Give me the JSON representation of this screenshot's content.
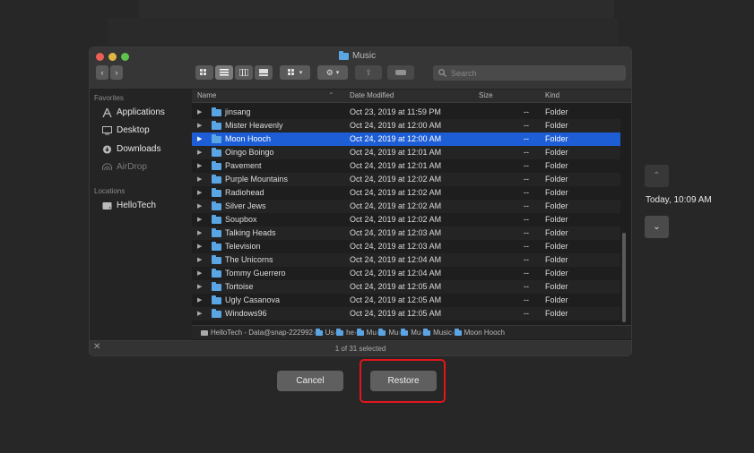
{
  "window": {
    "title": "Music",
    "search_placeholder": "Search"
  },
  "sidebar": {
    "favorites_label": "Favorites",
    "favorites": [
      {
        "label": "Applications",
        "icon": "applications-icon"
      },
      {
        "label": "Desktop",
        "icon": "desktop-icon"
      },
      {
        "label": "Downloads",
        "icon": "downloads-icon"
      },
      {
        "label": "AirDrop",
        "icon": "airdrop-icon"
      }
    ],
    "locations_label": "Locations",
    "locations": [
      {
        "label": "HelloTech",
        "icon": "disk-icon"
      }
    ]
  },
  "columns": {
    "name": "Name",
    "date": "Date Modified",
    "size": "Size",
    "kind": "Kind"
  },
  "rows": [
    {
      "name": "jinsang",
      "date": "Oct 23, 2019 at 11:59 PM",
      "size": "--",
      "kind": "Folder",
      "selected": false
    },
    {
      "name": "Mister Heavenly",
      "date": "Oct 24, 2019 at 12:00 AM",
      "size": "--",
      "kind": "Folder",
      "selected": false
    },
    {
      "name": "Moon Hooch",
      "date": "Oct 24, 2019 at 12:00 AM",
      "size": "--",
      "kind": "Folder",
      "selected": true
    },
    {
      "name": "Oingo Boingo",
      "date": "Oct 24, 2019 at 12:01 AM",
      "size": "--",
      "kind": "Folder",
      "selected": false
    },
    {
      "name": "Pavement",
      "date": "Oct 24, 2019 at 12:01 AM",
      "size": "--",
      "kind": "Folder",
      "selected": false
    },
    {
      "name": "Purple Mountains",
      "date": "Oct 24, 2019 at 12:02 AM",
      "size": "--",
      "kind": "Folder",
      "selected": false
    },
    {
      "name": "Radiohead",
      "date": "Oct 24, 2019 at 12:02 AM",
      "size": "--",
      "kind": "Folder",
      "selected": false
    },
    {
      "name": "Silver Jews",
      "date": "Oct 24, 2019 at 12:02 AM",
      "size": "--",
      "kind": "Folder",
      "selected": false
    },
    {
      "name": "Soupbox",
      "date": "Oct 24, 2019 at 12:02 AM",
      "size": "--",
      "kind": "Folder",
      "selected": false
    },
    {
      "name": "Talking Heads",
      "date": "Oct 24, 2019 at 12:03 AM",
      "size": "--",
      "kind": "Folder",
      "selected": false
    },
    {
      "name": "Television",
      "date": "Oct 24, 2019 at 12:03 AM",
      "size": "--",
      "kind": "Folder",
      "selected": false
    },
    {
      "name": "The Unicorns",
      "date": "Oct 24, 2019 at 12:04 AM",
      "size": "--",
      "kind": "Folder",
      "selected": false
    },
    {
      "name": "Tommy Guerrero",
      "date": "Oct 24, 2019 at 12:04 AM",
      "size": "--",
      "kind": "Folder",
      "selected": false
    },
    {
      "name": "Tortoise",
      "date": "Oct 24, 2019 at 12:05 AM",
      "size": "--",
      "kind": "Folder",
      "selected": false
    },
    {
      "name": "Ugly Casanova",
      "date": "Oct 24, 2019 at 12:05 AM",
      "size": "--",
      "kind": "Folder",
      "selected": false
    },
    {
      "name": "Windows96",
      "date": "Oct 24, 2019 at 12:05 AM",
      "size": "--",
      "kind": "Folder",
      "selected": false
    }
  ],
  "pathbar": [
    "HelloTech - Data@snap-222992",
    "Us",
    "he",
    "Mu",
    "Mu",
    "Mu",
    "Music",
    "Moon Hooch"
  ],
  "status": "1 of 31 selected",
  "buttons": {
    "cancel": "Cancel",
    "restore": "Restore"
  },
  "timemachine": {
    "time": "Today, 10:09 AM"
  },
  "colors": {
    "selection": "#1d5ed6",
    "folder": "#5aa6e4",
    "highlight": "#e3151c"
  }
}
